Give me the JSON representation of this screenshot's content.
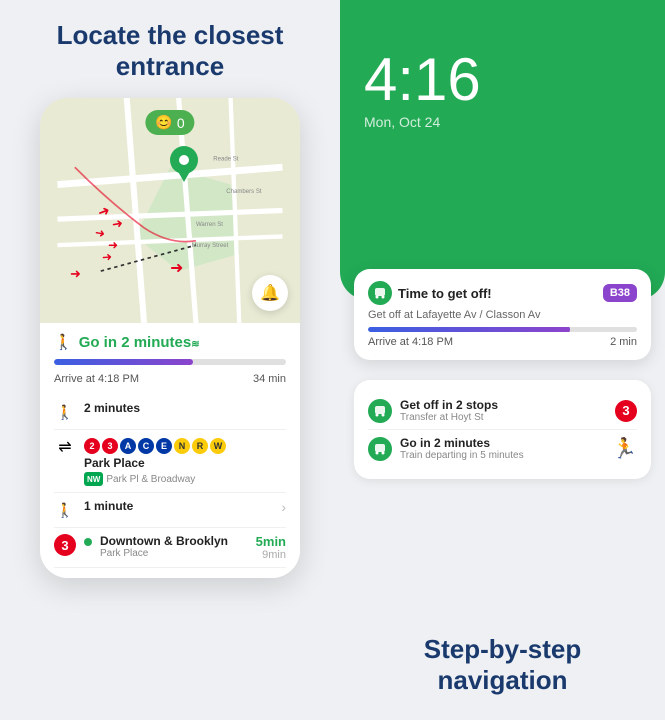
{
  "left": {
    "heading": "Locate the closest entrance",
    "map": {
      "emoji": "😊",
      "emoji_count": "0"
    },
    "bottom_card": {
      "go_label": "Go in ",
      "go_minutes": "2 minutes",
      "arrive_label": "Arrive at 4:18 PM",
      "duration": "34 min",
      "progress_pct": 60
    },
    "steps": [
      {
        "type": "walk",
        "label": "2 minutes",
        "icon": "🚶"
      },
      {
        "type": "transit",
        "title": "Park Place",
        "sub": "Park Pl & Broadway",
        "badges": [
          "2",
          "3",
          "A",
          "C",
          "E",
          "N",
          "R",
          "W"
        ],
        "nw_badge": "NW"
      },
      {
        "type": "walk",
        "label": "1 minute",
        "icon": "🚶",
        "has_arrow": true
      },
      {
        "type": "train",
        "number": "3",
        "title": "Downtown & Brooklyn",
        "sub": "Park Place",
        "time_green": "5min",
        "time_gray": "9min"
      }
    ]
  },
  "right": {
    "clock": "4:16",
    "date": "Mon, Oct 24",
    "notif_card": {
      "title": "Time to get off!",
      "sub": "Get off at Lafayette Av / Classon Av",
      "bus_badge": "B38",
      "arrive_label": "Arrive at 4:18 PM",
      "time_label": "2 min",
      "progress_pct": 75
    },
    "secondary_card": {
      "items": [
        {
          "title": "Get off in 2 stops",
          "sub": "Transfer at Hoyt St",
          "icon_type": "transit",
          "right_badge": "3"
        },
        {
          "title": "Go in 2 minutes",
          "sub": "Train departing in 5 minutes",
          "icon_type": "transit",
          "right_icon": "walk"
        }
      ]
    },
    "bottom_heading_line1": "Step-by-step",
    "bottom_heading_line2": "navigation"
  }
}
